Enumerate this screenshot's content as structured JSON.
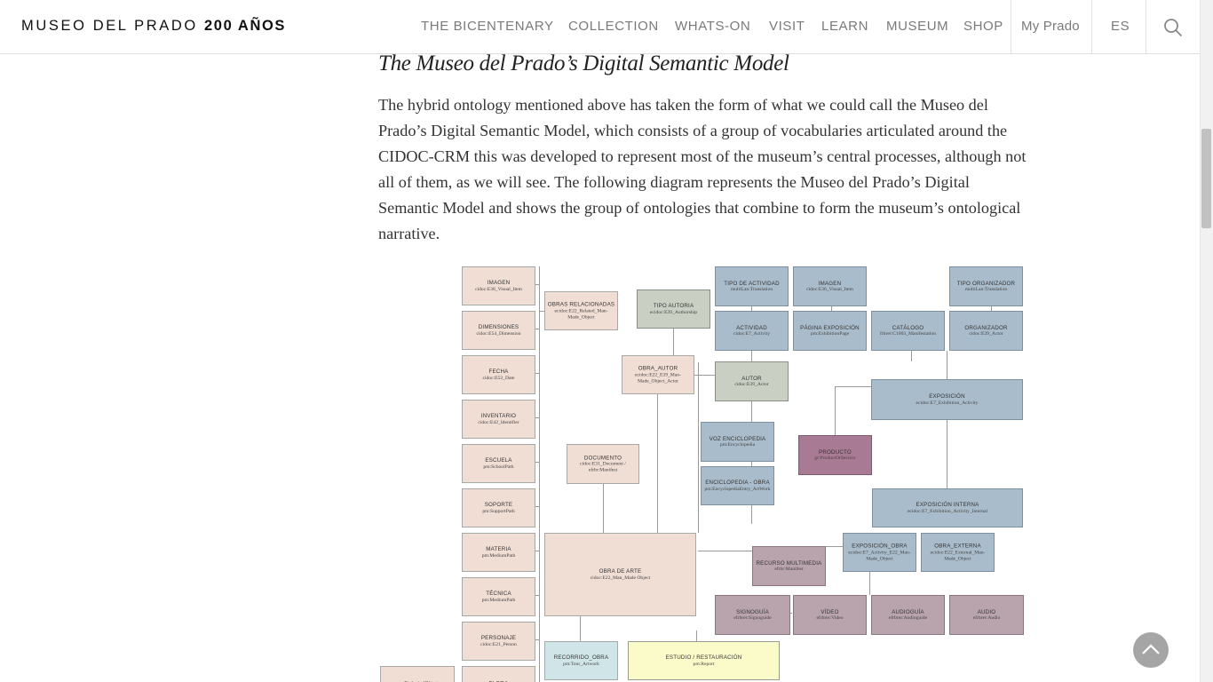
{
  "header": {
    "logo_text": "MUSEO DEL PRADO",
    "logo_bold": "200 AÑOS",
    "nav": [
      "THE BICENTENARY",
      "COLLECTION",
      "WHATS-ON",
      "VISIT",
      "LEARN",
      "MUSEUM",
      "SHOP"
    ],
    "my_prado": "My Prado",
    "language": "ES"
  },
  "article": {
    "heading": "The Museo del Prado’s Digital Semantic Model",
    "paragraph": "The hybrid ontology mentioned above has taken the form of what we could call the Museo del Prado’s Digital Semantic Model, which consists of a group of vocabularies articulated around the CIDOC-CRM this was developed to represent most of the museum’s central processes, although not all of them, as we will see. The following diagram represents the Museo del Prado’s Digital Semantic Model and shows the group of ontologies that combine to form the museum’s ontological narrative."
  },
  "diagram": {
    "boxes": [
      {
        "title": "IMAGEN",
        "sub": "cidoc:E38_Visual_Item",
        "color": "pink"
      },
      {
        "title": "DIMENSIONES",
        "sub": "cidoc:E54_Dimension",
        "color": "pink"
      },
      {
        "title": "FECHA",
        "sub": "cidoc:E52_Date",
        "color": "pink"
      },
      {
        "title": "INVENTARIO",
        "sub": "cidoc:E42_Identifier",
        "color": "pink"
      },
      {
        "title": "ESCUELA",
        "sub": "pm:SchoolPath",
        "color": "pink"
      },
      {
        "title": "SOPORTE",
        "sub": "pm:SupportPath",
        "color": "pink"
      },
      {
        "title": "MATERIA",
        "sub": "pm:MediumPath",
        "color": "pink"
      },
      {
        "title": "TÉCNICA",
        "sub": "pm:MediumPath",
        "color": "pink"
      },
      {
        "title": "PERSONAJE",
        "sub": "cidoc:E21_Person",
        "color": "pink"
      },
      {
        "title": "FLORA",
        "sub": "",
        "color": "pink"
      },
      {
        "title": "",
        "sub": "pm:BiologicalObject",
        "color": "pink"
      },
      {
        "title": "OBRAS RELACIONADAS",
        "sub": "ecidoc:E22_Related_Man-Made_Object",
        "color": "pink"
      },
      {
        "title": "TIPO AUTORIA",
        "sub": "ecidoc:E39_Authorship",
        "color": "grey"
      },
      {
        "title": "OBRA_AUTOR",
        "sub": "ecidoc:E22_E39_Man-Made_Object_Actor",
        "color": "pink"
      },
      {
        "title": "DOCUMENTO",
        "sub": "cidoc:E31_Document / efrbr:Manifest",
        "color": "pink"
      },
      {
        "title": "OBRA DE ARTE",
        "sub": "cidoc:E22_Man_Made Object",
        "color": "pink"
      },
      {
        "title": "RECORRIDO_OBRA",
        "sub": "pm:Tour_Artwork",
        "color": "teal"
      },
      {
        "title": "ESTUDIO / RESTAURACIÓN",
        "sub": "pm:Report",
        "color": "yellow"
      },
      {
        "title": "TIPO DE ACTIVIDAD",
        "sub": "multiLan:Translation",
        "color": "blue"
      },
      {
        "title": "IMAGEN",
        "sub": "cidoc:E36_Visual_Item",
        "color": "blue"
      },
      {
        "title": "TIPO ORGANIZADOR",
        "sub": "multiLan:Translation",
        "color": "blue"
      },
      {
        "title": "ACTIVIDAD",
        "sub": "cidoc:E7_Activity",
        "color": "blue"
      },
      {
        "title": "PÁGINA EXPOSICIÓN",
        "sub": "pm:ExhibitionPage",
        "color": "blue"
      },
      {
        "title": "CATÁLOGO",
        "sub": "frbrer:C1003_Manifestation",
        "color": "blue"
      },
      {
        "title": "ORGANIZADOR",
        "sub": "cidoc:E39_Actor",
        "color": "blue"
      },
      {
        "title": "AUTOR",
        "sub": "cidoc:E39_Actor",
        "color": "grey"
      },
      {
        "title": "EXPOSICIÓN",
        "sub": "ecidoc:E7_Exhibition_Activity",
        "color": "blue"
      },
      {
        "title": "VOZ ENCICLOPEDIA",
        "sub": "pm:Encyclopedia",
        "color": "blue"
      },
      {
        "title": "ENCICLOPEDIA - OBRA",
        "sub": "pm:EncyclopediaEntry_ArtWork",
        "color": "blue"
      },
      {
        "title": "PRODUCTO",
        "sub": "gr:ProductOrService",
        "color": "magenta"
      },
      {
        "title": "EXPOSICIÓN INTERNA",
        "sub": "ecidoc:E7_Exhibition_Activity_Internal",
        "color": "blue"
      },
      {
        "title": "EXPOSICIÓN_OBRA",
        "sub": "ecidoc:E7_Activity_E22_Man-Made_Object",
        "color": "blue"
      },
      {
        "title": "OBRA_EXTERNA",
        "sub": "ecidoc:E22_External_Man-Made_Object",
        "color": "blue"
      },
      {
        "title": "RECURSO MULTIMEDIA",
        "sub": "efrbr:Manifest",
        "color": "mauve"
      },
      {
        "title": "SIGNOGUÍA",
        "sub": "efrbrer:Signoguide",
        "color": "mauve"
      },
      {
        "title": "VÍDEO",
        "sub": "efrbrer:Video",
        "color": "mauve"
      },
      {
        "title": "AUDIOGUÍA",
        "sub": "efrbrer:Audioguide",
        "color": "mauve"
      },
      {
        "title": "AUDIO",
        "sub": "efrbrer:Audio",
        "color": "mauve"
      }
    ]
  }
}
